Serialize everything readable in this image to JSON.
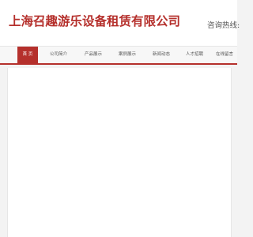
{
  "header": {
    "company_name": "上海召趣游乐设备租赁有限公司",
    "hotline_label": "咨询热线:"
  },
  "nav": {
    "items": [
      {
        "label": "首 页",
        "active": true
      },
      {
        "label": "公司简介",
        "active": false
      },
      {
        "label": "产品展示",
        "active": false
      },
      {
        "label": "案例展示",
        "active": false
      },
      {
        "label": "新闻动态",
        "active": false
      },
      {
        "label": "人才招聘",
        "active": false
      },
      {
        "label": "在线留言",
        "active": false
      }
    ]
  },
  "colors": {
    "brand": "#b5302c",
    "background": "#f3f3f3"
  }
}
